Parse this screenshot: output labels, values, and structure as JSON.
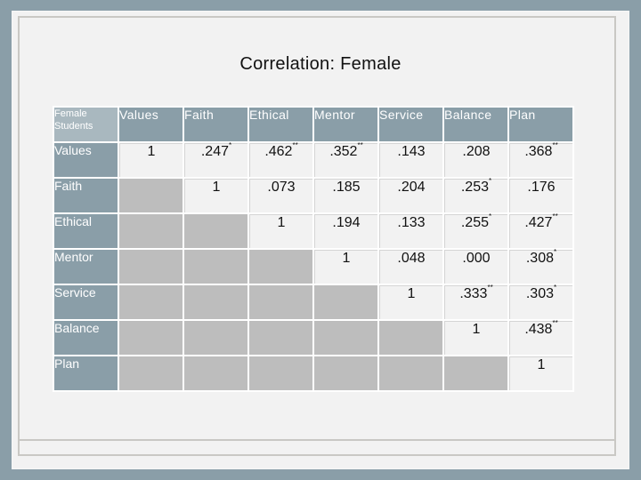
{
  "title": "Correlation: Female",
  "table": {
    "corner_label_line1": "Female",
    "corner_label_line2": "Students",
    "columns": [
      "Values",
      "Faith",
      "Ethical",
      "Mentor",
      "Service",
      "Balance",
      "Plan"
    ],
    "rows": [
      {
        "label": "Values",
        "cells": [
          {
            "v": "1",
            "sig": ""
          },
          {
            "v": ".247",
            "sig": "*"
          },
          {
            "v": ".462",
            "sig": "**"
          },
          {
            "v": ".352",
            "sig": "**"
          },
          {
            "v": ".143",
            "sig": ""
          },
          {
            "v": ".208",
            "sig": ""
          },
          {
            "v": ".368",
            "sig": "**"
          }
        ]
      },
      {
        "label": "Faith",
        "cells": [
          null,
          {
            "v": "1",
            "sig": ""
          },
          {
            "v": ".073",
            "sig": ""
          },
          {
            "v": ".185",
            "sig": ""
          },
          {
            "v": ".204",
            "sig": ""
          },
          {
            "v": ".253",
            "sig": "*"
          },
          {
            "v": ".176",
            "sig": ""
          }
        ]
      },
      {
        "label": "Ethical",
        "cells": [
          null,
          null,
          {
            "v": "1",
            "sig": ""
          },
          {
            "v": ".194",
            "sig": ""
          },
          {
            "v": ".133",
            "sig": ""
          },
          {
            "v": ".255",
            "sig": "*"
          },
          {
            "v": ".427",
            "sig": "**"
          }
        ]
      },
      {
        "label": "Mentor",
        "cells": [
          null,
          null,
          null,
          {
            "v": "1",
            "sig": ""
          },
          {
            "v": ".048",
            "sig": ""
          },
          {
            "v": ".000",
            "sig": ""
          },
          {
            "v": ".308",
            "sig": "*"
          }
        ]
      },
      {
        "label": "Service",
        "cells": [
          null,
          null,
          null,
          null,
          {
            "v": "1",
            "sig": ""
          },
          {
            "v": ".333",
            "sig": "**"
          },
          {
            "v": ".303",
            "sig": "*"
          }
        ]
      },
      {
        "label": "Balance",
        "cells": [
          null,
          null,
          null,
          null,
          null,
          {
            "v": "1",
            "sig": ""
          },
          {
            "v": ".438",
            "sig": "**"
          }
        ]
      },
      {
        "label": "Plan",
        "cells": [
          null,
          null,
          null,
          null,
          null,
          null,
          {
            "v": "1",
            "sig": ""
          }
        ]
      }
    ]
  },
  "colors": {
    "background": "#8a9ea8",
    "header_fill": "#8a9ea8",
    "corner_fill": "#a9b8bf",
    "blank_cell_fill": "#bdbdbd",
    "value_cell_fill": "#f2f2f2"
  }
}
